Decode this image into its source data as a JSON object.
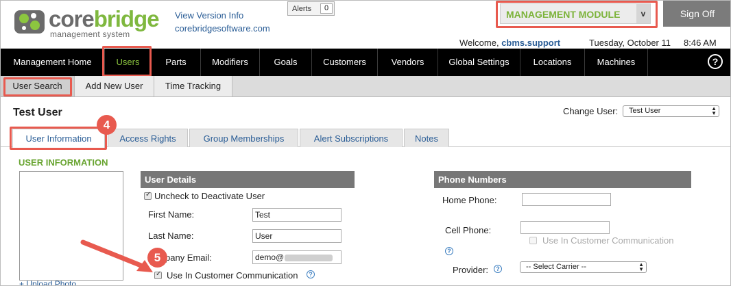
{
  "brand": {
    "name_part1": "core",
    "name_part2": "bridge",
    "tagline": "management system"
  },
  "header": {
    "view_version": "View Version Info",
    "site_link": "corebridgesoftware.com",
    "alerts_label": "Alerts",
    "alerts_count": "0",
    "module": "MANAGEMENT MODULE",
    "module_arrow": "v",
    "sign_off": "Sign Off",
    "welcome_prefix": "Welcome,",
    "username": "cbms.support",
    "date": "Tuesday, October 11",
    "time": "8:46 AM"
  },
  "nav": {
    "items": [
      "Management Home",
      "Users",
      "Parts",
      "Modifiers",
      "Goals",
      "Customers",
      "Vendors",
      "Global Settings",
      "Locations",
      "Machines"
    ],
    "active": "Users",
    "help": "?"
  },
  "subnav": {
    "items": [
      "User Search",
      "Add New User",
      "Time Tracking"
    ]
  },
  "page": {
    "title": "Test User",
    "change_user_label": "Change User:",
    "change_user_value": "Test User"
  },
  "tabs": {
    "items": [
      "User Information",
      "Access Rights",
      "Group Memberships",
      "Alert Subscriptions",
      "Notes"
    ],
    "active": "User Information"
  },
  "callouts": {
    "step4": "4",
    "step5": "5"
  },
  "user_info": {
    "section_title": "USER INFORMATION",
    "upload_photo": "+ Upload Photo"
  },
  "user_details": {
    "header": "User Details",
    "deactivate_label": "Uncheck to Deactivate User",
    "first_name_label": "First Name:",
    "first_name_value": "Test",
    "last_name_label": "Last Name:",
    "last_name_value": "User",
    "email_label": "pany Email:",
    "email_value": "demo@",
    "use_in_comm_label": "Use In Customer Communication",
    "info_icon": "?"
  },
  "phone_numbers": {
    "header": "Phone Numbers",
    "home_phone_label": "Home Phone:",
    "cell_phone_label": "Cell Phone:",
    "cell_use_in_comm_label": "Use In Customer Communication",
    "provider_label": "Provider:",
    "provider_value": "-- Select Carrier --",
    "info_icon": "?"
  },
  "colors": {
    "accent_green": "#7fb83f",
    "link_blue": "#2a5d96",
    "callout_red": "#e85a4f"
  }
}
